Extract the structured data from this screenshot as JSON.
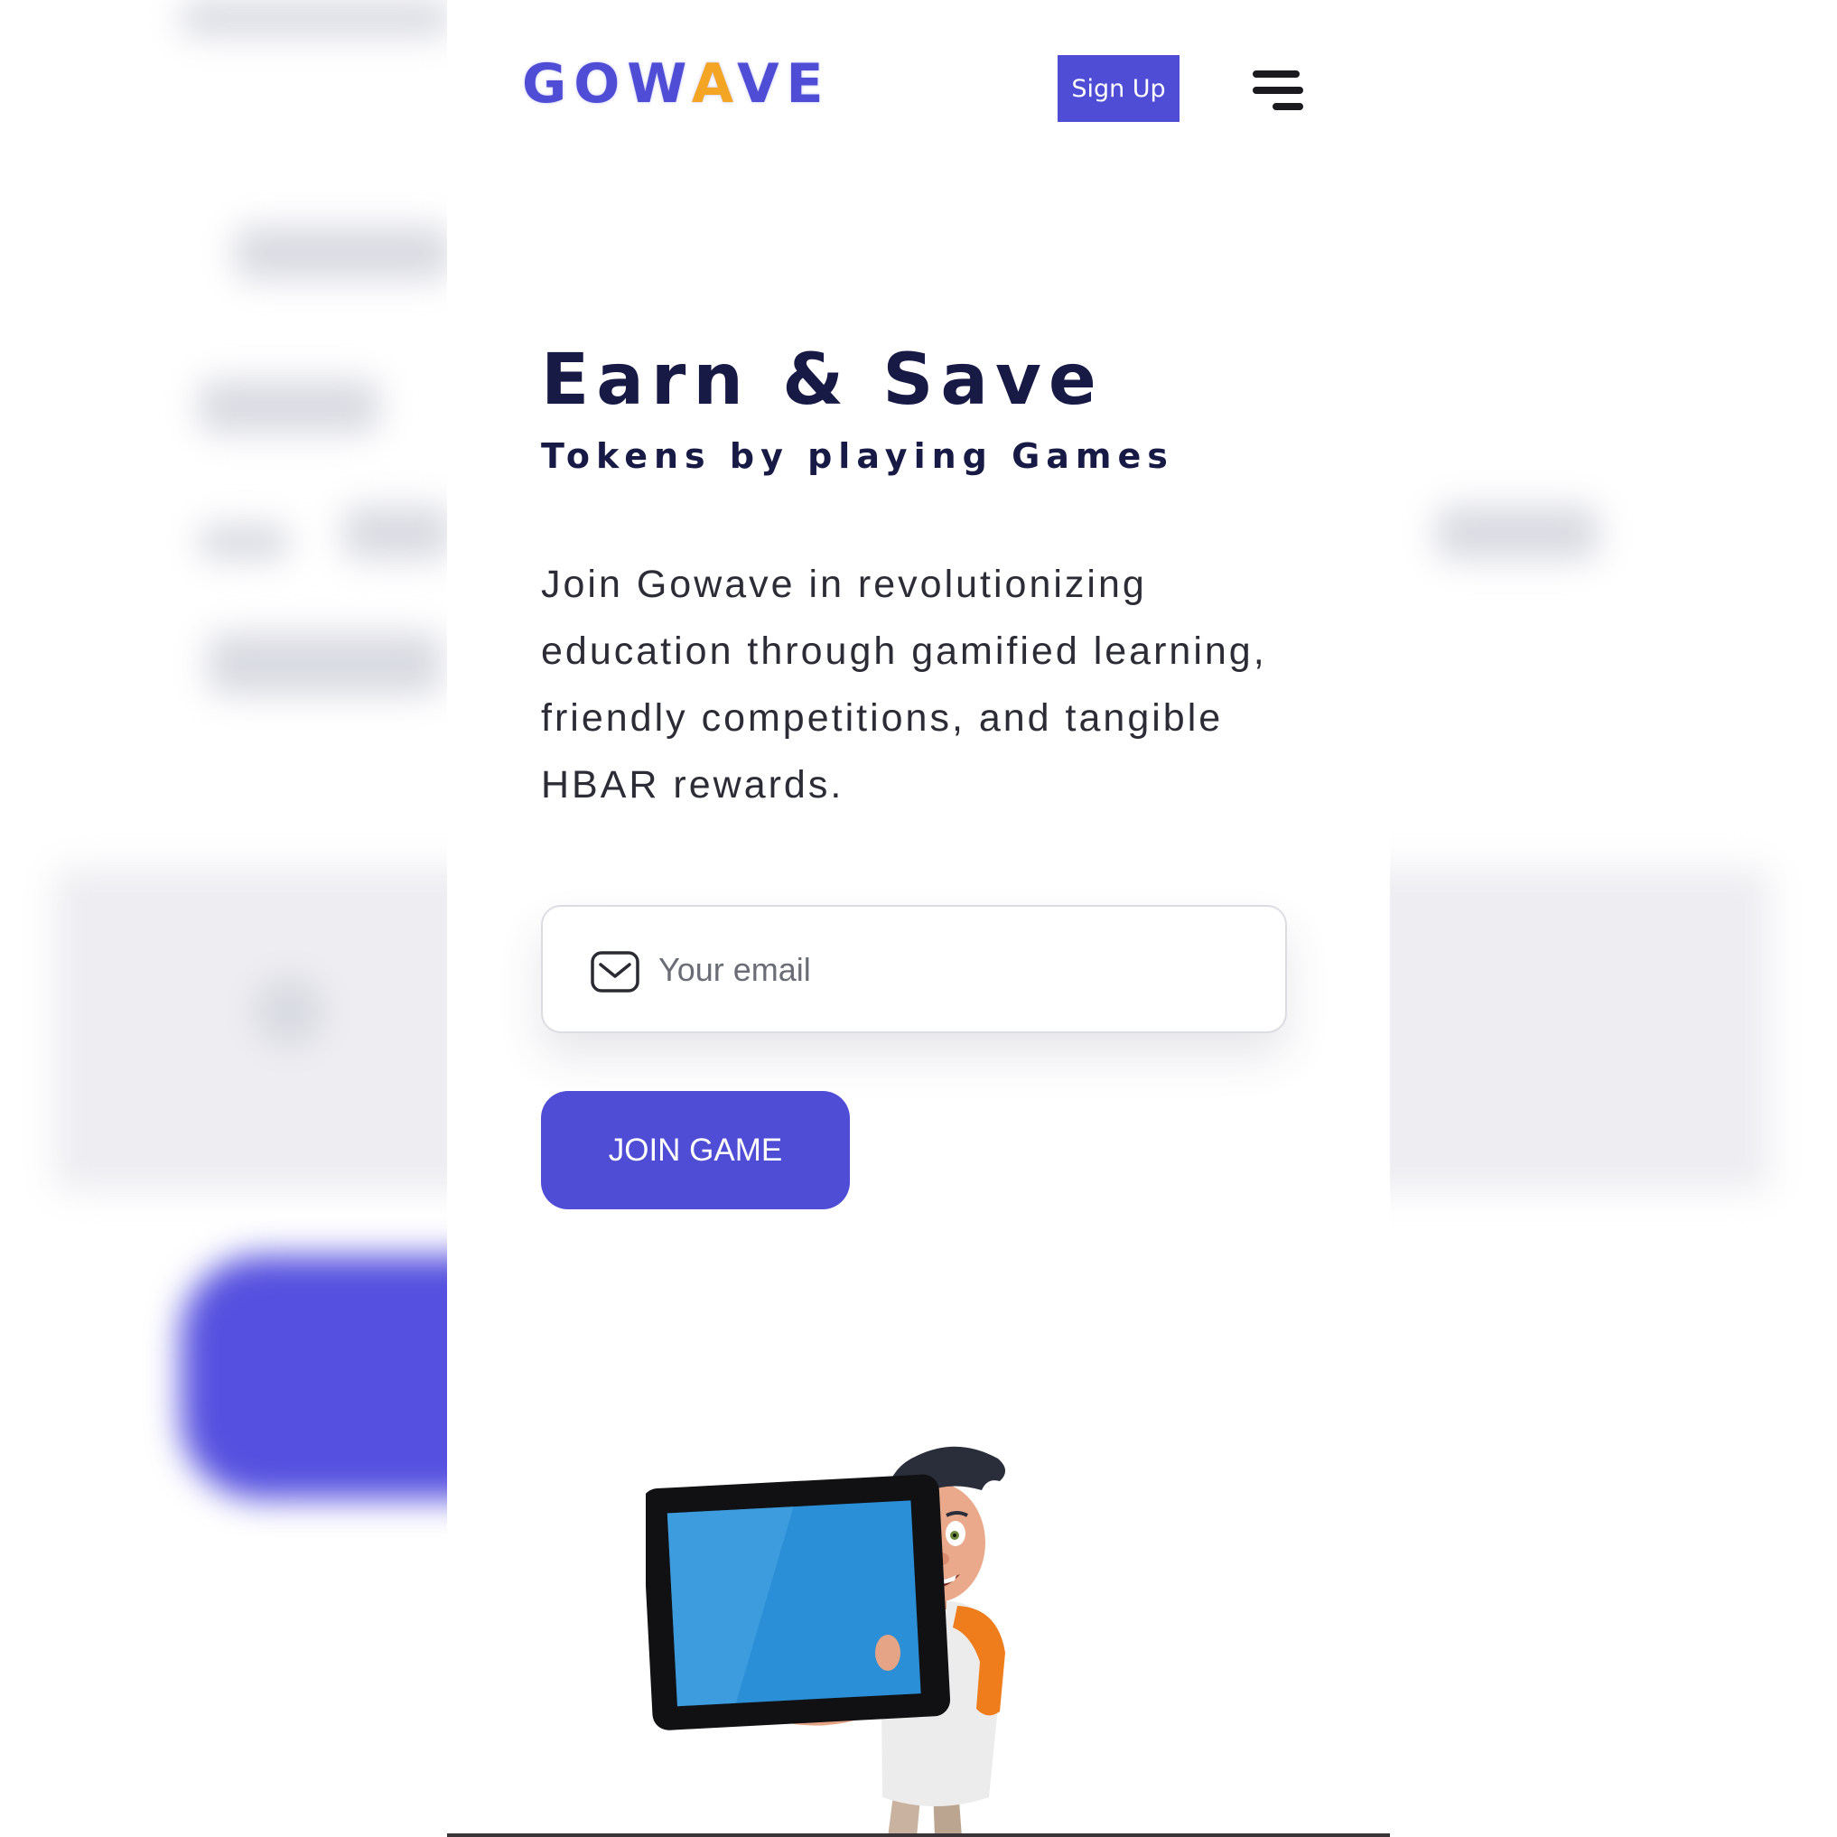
{
  "header": {
    "logo_prefix": "GOW",
    "logo_accent": "A",
    "logo_suffix": "VE",
    "signup_label": "Sign Up",
    "menu_icon": "hamburger-menu-icon"
  },
  "hero": {
    "title": "Earn & Save",
    "subtitle": "Tokens by playing Games",
    "description": "Join Gowave in revolutionizing education through gamified learning, friendly competitions, and tangible HBAR rewards."
  },
  "form": {
    "email_placeholder": "Your email",
    "email_value": "",
    "email_icon": "envelope-icon",
    "join_label": "JOIN GAME"
  },
  "illustration": {
    "icon": "boy-holding-tablet-illustration"
  },
  "colors": {
    "brand": "#4f4cd6",
    "logo_accent": "#f5a524",
    "heading": "#181a46",
    "body_text": "#2c2c36",
    "background": "#ffffff"
  }
}
